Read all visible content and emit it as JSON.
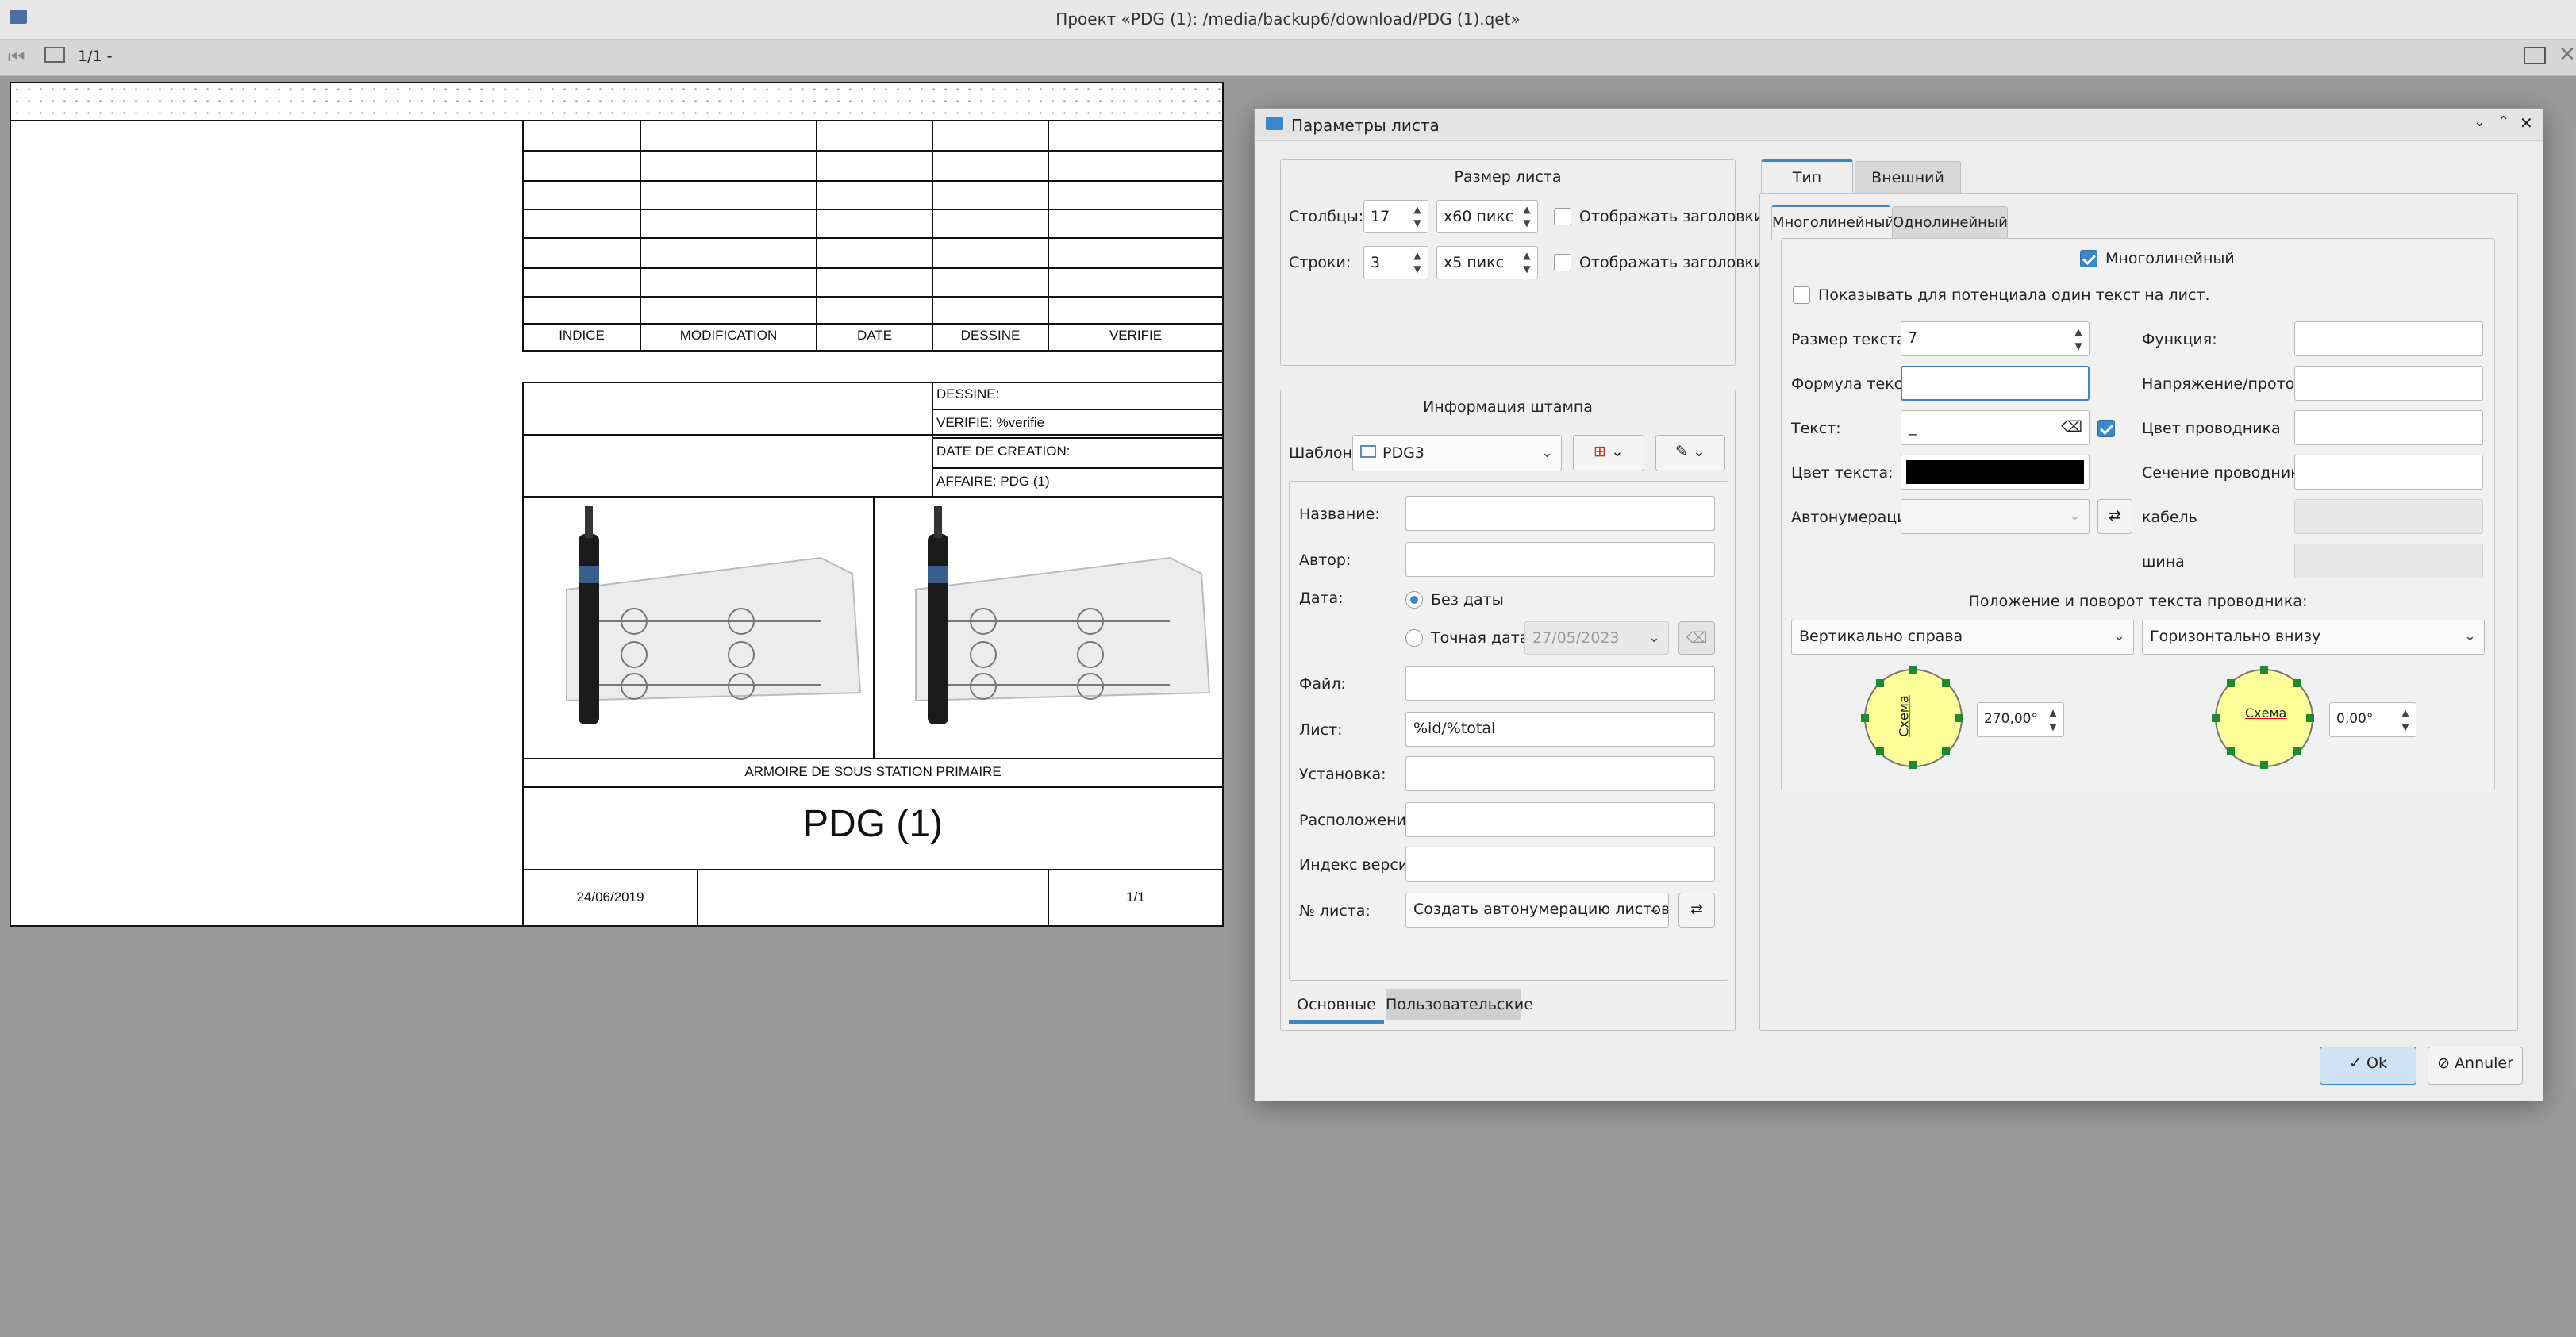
{
  "window": {
    "title": "Проект «PDG (1): /media/backup6/download/PDG (1).qet»",
    "page_indicator": "1/1 -"
  },
  "folio": {
    "revision_headers": [
      "INDICE",
      "MODIFICATION",
      "DATE",
      "DESSINE",
      "VERIFIE"
    ],
    "info_rows": [
      "DESSINE:",
      "VERIFIE: %verifie",
      "DATE DE CREATION:",
      "AFFAIRE: PDG (1)"
    ],
    "subtitle": "ARMOIRE DE SOUS STATION PRIMAIRE",
    "title": "PDG (1)",
    "date": "24/06/2019",
    "folio_number": "1/1"
  },
  "dialog": {
    "title": "Параметры листа",
    "sheet_size": {
      "group_title": "Размер листа",
      "columns_label": "Столбцы:",
      "columns_value": "17",
      "columns_width": "x60 пикс",
      "rows_label": "Строки:",
      "rows_value": "3",
      "rows_height": "x5 пикс",
      "show_headers_label": "Отображать заголовки"
    },
    "stamp_info": {
      "group_title": "Информация штампа",
      "template_label": "Шаблон:",
      "template_value": "PDG3",
      "title_label": "Название:",
      "author_label": "Автор:",
      "date_label": "Дата:",
      "no_date_label": "Без даты",
      "exact_date_label": "Точная дата:",
      "exact_date_value": "27/05/2023",
      "file_label": "Файл:",
      "sheet_label": "Лист:",
      "sheet_value": "%id/%total",
      "installation_label": "Установка:",
      "location_label": "Расположение:",
      "version_label": "Индекс версии:",
      "sheet_no_label": "№ листа:",
      "sheet_no_value": "Создать автонумерацию листов",
      "tab_main": "Основные",
      "tab_custom": "Пользовательские"
    },
    "right_panel": {
      "tab_type": "Тип",
      "tab_appearance": "Внешний вид",
      "subtab_multi": "Многолинейный",
      "subtab_single": "Однолинейный",
      "multiline_checkbox": "Многолинейный",
      "show_potential_text": "Показывать для потенциала один текст на лист.",
      "text_size_label": "Размер текста:",
      "text_size_value": "7",
      "formula_label": "Формула текста:",
      "text_label": "Текст:",
      "text_value": "_",
      "text_color_label": "Цвет текста:",
      "text_color": "#000000",
      "autonum_label": "Автонумерация",
      "function_label": "Функция:",
      "voltage_label": "Напряжение/протокол:",
      "wire_color_label": "Цвет проводника",
      "wire_section_label": "Сечение проводника",
      "cable_label": "кабель",
      "bus_label": "шина",
      "position_title": "Положение и поворот текста проводника:",
      "vertical_value": "Вертикально справа",
      "horizontal_value": "Горизонтально внизу",
      "dial_text": "Схема",
      "vertical_angle": "270,00°",
      "horizontal_angle": "0,00°"
    },
    "ok_label": "Ok",
    "cancel_label": "Annuler"
  },
  "colors": {
    "accent": "#3b87c9",
    "dial_fill": "#ffff99",
    "dial_handle": "#1c8a2e"
  }
}
